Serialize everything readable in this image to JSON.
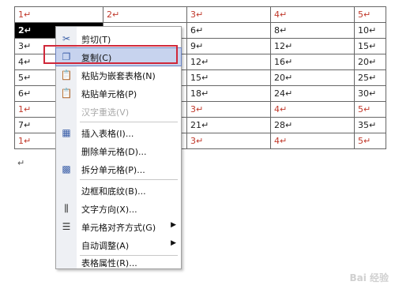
{
  "table": {
    "rows": [
      [
        "1↵",
        "2↵",
        "3↵",
        "4↵",
        "5↵"
      ],
      [
        "2↵",
        "",
        "6↵",
        "8↵",
        "10↵"
      ],
      [
        "3↵",
        "",
        "9↵",
        "12↵",
        "15↵"
      ],
      [
        "4↵",
        "",
        "12↵",
        "16↵",
        "20↵"
      ],
      [
        "5↵",
        "",
        "15↵",
        "20↵",
        "25↵"
      ],
      [
        "6↵",
        "",
        "18↵",
        "24↵",
        "30↵"
      ],
      [
        "1↵",
        "",
        "3↵",
        "4↵",
        "5↵"
      ],
      [
        "7↵",
        "",
        "21↵",
        "28↵",
        "35↵"
      ],
      [
        "1↵",
        "",
        "3↵",
        "4↵",
        "5↵"
      ]
    ]
  },
  "para_mark": "↵",
  "menu": {
    "cut": "剪切(T)",
    "copy": "复制(C)",
    "paste_nested": "粘贴为嵌套表格(N)",
    "paste_cells": "粘贴单元格(P)",
    "reconvert": "汉字重选(V)",
    "insert_table": "插入表格(I)...",
    "delete_cells": "删除单元格(D)...",
    "split_cells": "拆分单元格(P)...",
    "borders": "边框和底纹(B)...",
    "text_direction": "文字方向(X)...",
    "cell_align": "单元格对齐方式(G)",
    "autofit": "自动调整(A)",
    "table_props": "表格属性(R)..."
  },
  "icons": {
    "cut": "scissors-icon",
    "copy": "copy-icon",
    "paste_nested": "paste-icon",
    "paste_cells": "paste-icon",
    "insert_table": "table-icon",
    "split_cells": "split-cells-icon",
    "text_direction": "text-direction-icon",
    "cell_align": "align-icon"
  },
  "colors": {
    "highlight": "#c7d3ee",
    "red_box": "#d0283a",
    "selected_cell": "#000000"
  },
  "watermark": "Bai 经验"
}
